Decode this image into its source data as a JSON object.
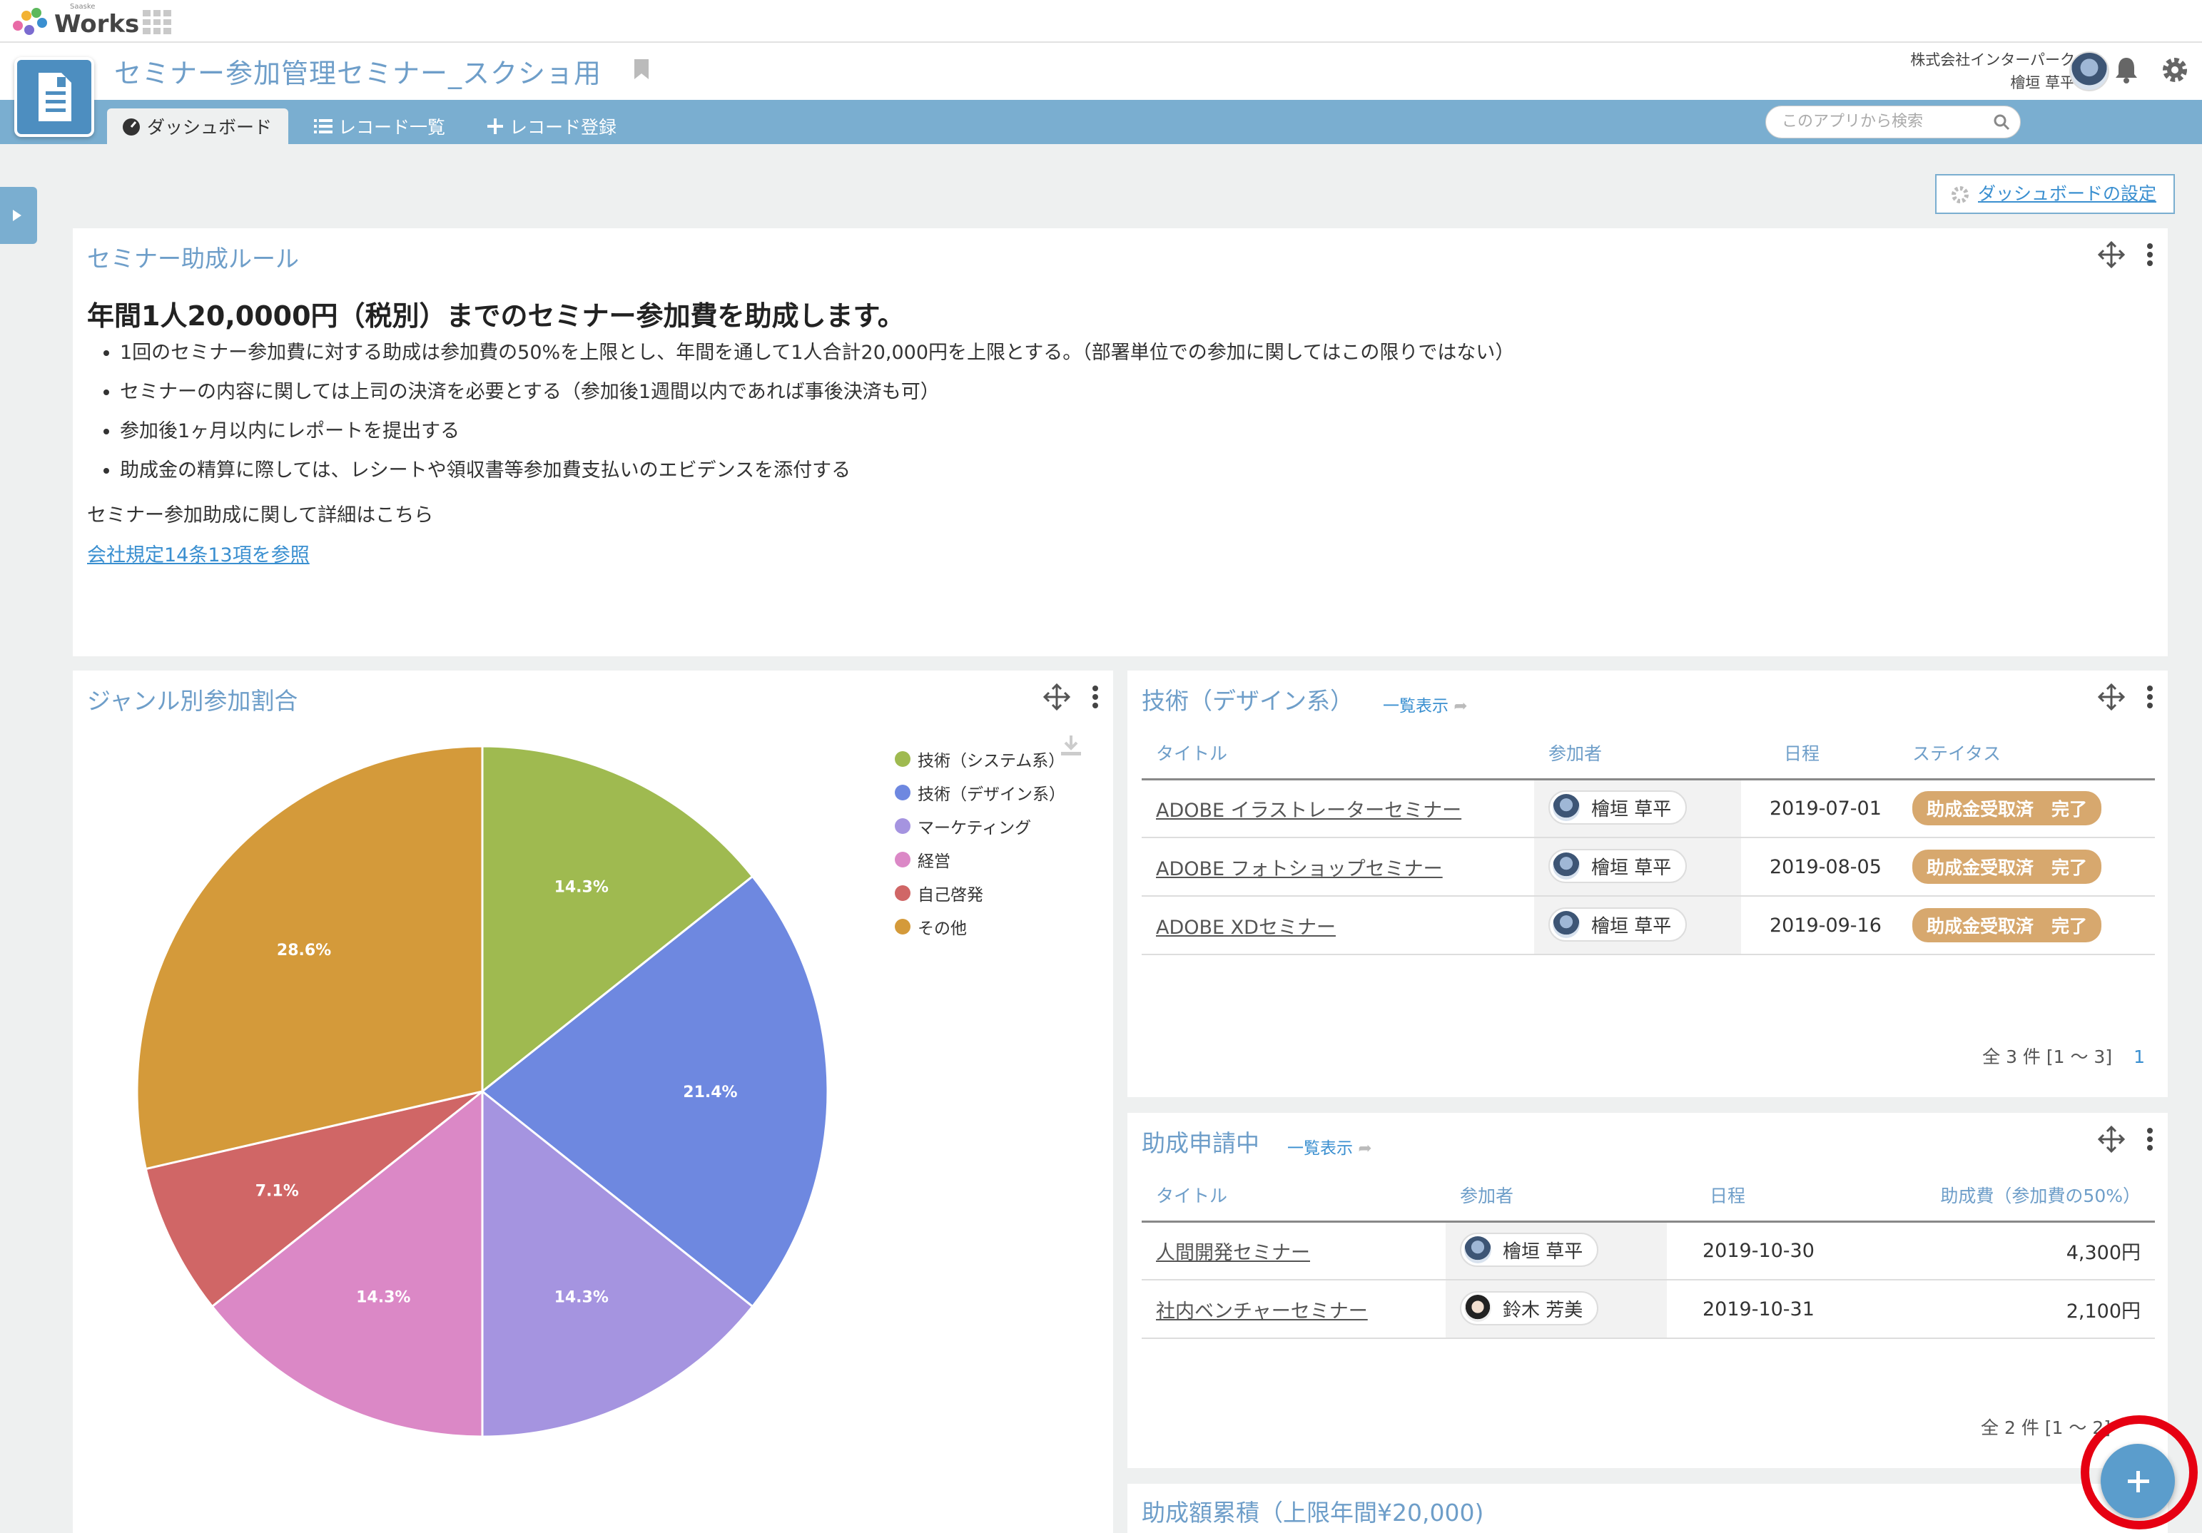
{
  "topbar": {
    "logo_text": "Works",
    "logo_small": "Saaske"
  },
  "app": {
    "title": "セミナー参加管理セミナー_スクショ用",
    "company": "株式会社インターパーク",
    "user": "檜垣 草平"
  },
  "nav": {
    "tabs": [
      {
        "label": "ダッシュボード"
      },
      {
        "label": "レコード一覧"
      },
      {
        "label": "レコード登録"
      }
    ],
    "search_placeholder": "このアプリから検索"
  },
  "dashboard_setting_label": "ダッシュボードの設定",
  "rules": {
    "title": "セミナー助成ルール",
    "heading": "年間1人20,0000円（税別）までのセミナー参加費を助成します。",
    "items": [
      "1回のセミナー参加費に対する助成は参加費の50%を上限とし、年間を通して1人合計20,000円を上限とする。（部署単位での参加に関してはこの限りではない）",
      "セミナーの内容に関しては上司の決済を必要とする（参加後1週間以内であれば事後決済も可）",
      "参加後1ヶ月以内にレポートを提出する",
      "助成金の精算に際しては、レシートや領収書等参加費支払いのエビデンスを添付する"
    ],
    "detail": "セミナー参加助成に関して詳細はこちら",
    "link": "会社規定14条13項を参照"
  },
  "chart_data": {
    "type": "pie",
    "title": "ジャンル別参加割合",
    "categories": [
      "技術（システム系）",
      "技術（デザイン系）",
      "マーケティング",
      "経営",
      "自己啓発",
      "その他"
    ],
    "values": [
      14.3,
      21.4,
      14.3,
      14.3,
      7.1,
      28.6
    ],
    "labels": [
      "14.3%",
      "21.4%",
      "14.3%",
      "14.3%",
      "7.1%",
      "28.6%"
    ],
    "colors": [
      "#9fba50",
      "#6e88e0",
      "#a594e0",
      "#db88c6",
      "#d06666",
      "#d49a3a"
    ],
    "legend": "right"
  },
  "tech_design": {
    "title": "技術（デザイン系）",
    "list_link": "一覧表示",
    "columns": [
      "タイトル",
      "参加者",
      "日程",
      "ステイタス"
    ],
    "rows": [
      {
        "title": "ADOBE イラストレーターセミナー",
        "user": "檜垣 草平",
        "date": "2019-07-01",
        "status": "助成金受取済　完了"
      },
      {
        "title": "ADOBE フォトショップセミナー",
        "user": "檜垣 草平",
        "date": "2019-08-05",
        "status": "助成金受取済　完了"
      },
      {
        "title": "ADOBE XDセミナー",
        "user": "檜垣 草平",
        "date": "2019-09-16",
        "status": "助成金受取済　完了"
      }
    ],
    "pager": "全 3 件 [1 〜 3]",
    "page": "1"
  },
  "applying": {
    "title": "助成申請中",
    "list_link": "一覧表示",
    "columns": [
      "タイトル",
      "参加者",
      "日程",
      "助成費（参加費の50%）"
    ],
    "rows": [
      {
        "title": "人間開発セミナー",
        "user": "檜垣 草平",
        "date": "2019-10-30",
        "amount": "4,300円"
      },
      {
        "title": "社内ベンチャーセミナー",
        "user": "鈴木 芳美",
        "date": "2019-10-31",
        "amount": "2,100円"
      }
    ],
    "pager": "全 2 件 [1 〜 2]"
  },
  "cumulative": {
    "title": "助成額累積（上限年間¥20,000)"
  }
}
